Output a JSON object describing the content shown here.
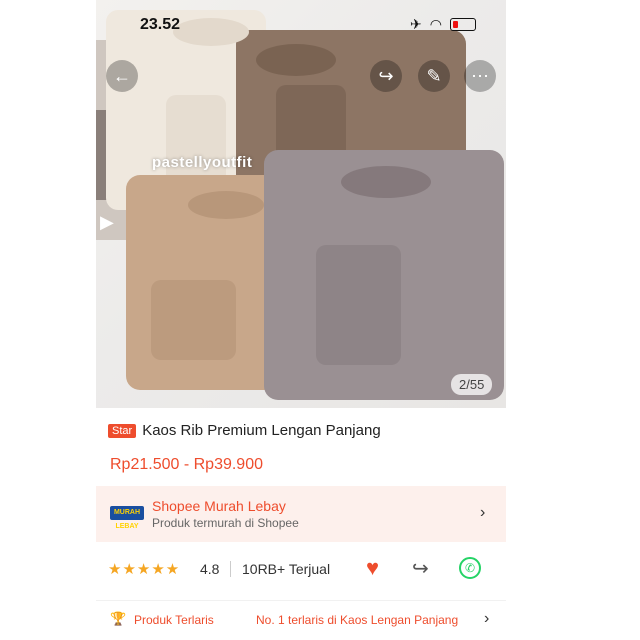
{
  "status_bar": {
    "time": "23.52"
  },
  "gallery": {
    "watermark": "pastellyoutfit",
    "counter": "2/55"
  },
  "product": {
    "badge": "Star",
    "title": "Kaos Rib Premium Lengan Panjang",
    "price": "Rp21.500 - Rp39.900"
  },
  "shop": {
    "logo_text": "MURAH LEBAY",
    "name": "Shopee Murah Lebay",
    "subtitle": "Produk termurah di Shopee"
  },
  "stats": {
    "rating": "4.8",
    "rating_value": 4.5,
    "sold": "10RB+ Terjual"
  },
  "best_seller": {
    "label": "Produk Terlaris",
    "description": "No. 1 terlaris di Kaos Lengan Panjang"
  },
  "colors": {
    "accent": "#ee4d2d",
    "whatsapp": "#25d366",
    "star": "#f5a623"
  }
}
